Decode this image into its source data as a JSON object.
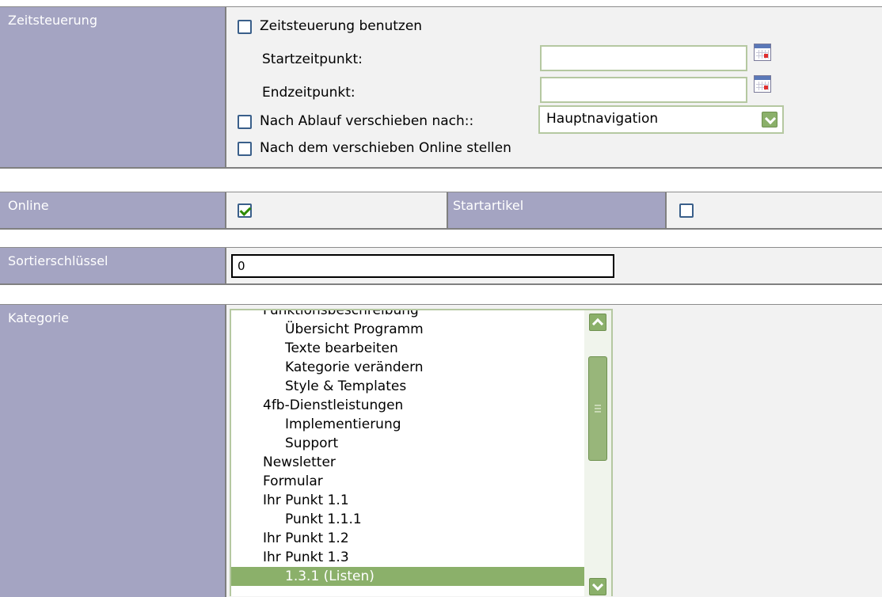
{
  "zeitsteuerung": {
    "label": "Zeitsteuerung",
    "use_label": "Zeitsteuerung benutzen",
    "start_label": "Startzeitpunkt:",
    "start_value": "",
    "end_label": "Endzeitpunkt:",
    "end_value": "",
    "move_label": "Nach Ablauf verschieben nach::",
    "move_select_value": "Hauptnavigation",
    "online_after_move_label": "Nach dem verschieben Online stellen"
  },
  "online": {
    "label": "Online",
    "checked": true,
    "startartikel_label": "Startartikel",
    "startartikel_checked": false
  },
  "sort": {
    "label": "Sortierschlüssel",
    "value": "0"
  },
  "kategorie": {
    "label": "Kategorie",
    "items": [
      {
        "text": "Funktionsbeschreibung",
        "indent": 1
      },
      {
        "text": "Übersicht Programm",
        "indent": 2
      },
      {
        "text": "Texte bearbeiten",
        "indent": 2
      },
      {
        "text": "Kategorie verändern",
        "indent": 2
      },
      {
        "text": "Style & Templates",
        "indent": 2
      },
      {
        "text": "4fb-Dienstleistungen",
        "indent": 1
      },
      {
        "text": "Implementierung",
        "indent": 2
      },
      {
        "text": "Support",
        "indent": 2
      },
      {
        "text": "Newsletter",
        "indent": 1
      },
      {
        "text": "Formular",
        "indent": 1
      },
      {
        "text": "Ihr Punkt 1.1",
        "indent": 1
      },
      {
        "text": "Punkt 1.1.1",
        "indent": 2
      },
      {
        "text": "Ihr Punkt 1.2",
        "indent": 1
      },
      {
        "text": "Ihr Punkt 1.3",
        "indent": 1
      },
      {
        "text": "1.3.1 (Listen)",
        "indent": 2,
        "selected": true
      }
    ]
  }
}
